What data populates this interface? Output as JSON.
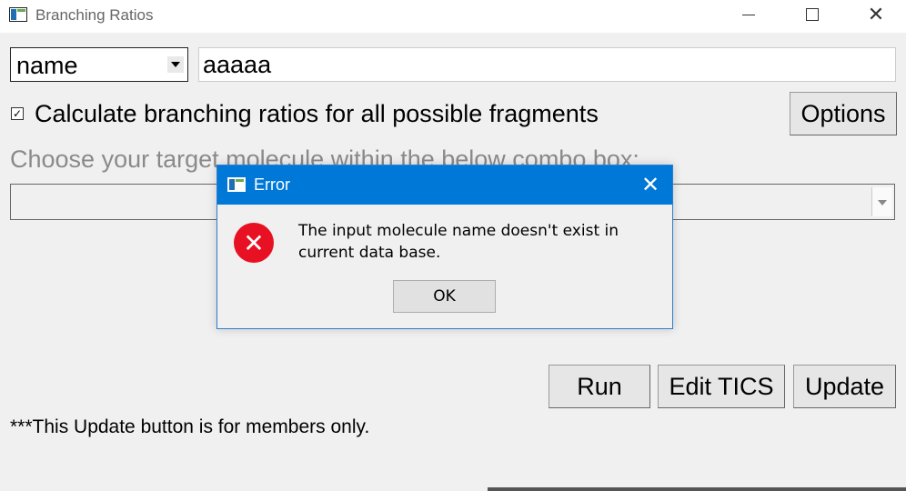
{
  "window": {
    "title": "Branching Ratios",
    "minimize_icon": "minimize-icon",
    "maximize_icon": "maximize-icon",
    "close_icon": "close-icon"
  },
  "search": {
    "mode_selected": "name",
    "query_value": "aaaaa"
  },
  "options": {
    "calculate_all_checked": true,
    "calculate_all_label": "Calculate branching ratios for all possible fragments",
    "options_button": "Options"
  },
  "target": {
    "label": "Choose your target molecule within the below combo box:",
    "selected": ""
  },
  "actions": {
    "run": "Run",
    "edit_tics": "Edit TICS",
    "update": "Update"
  },
  "note": "***This Update button is for members only.",
  "error_dialog": {
    "title": "Error",
    "message": "The input molecule name doesn't exist in current data base.",
    "ok": "OK",
    "icon": "error-icon",
    "accent": "#0078d7",
    "error_color": "#e81123"
  }
}
